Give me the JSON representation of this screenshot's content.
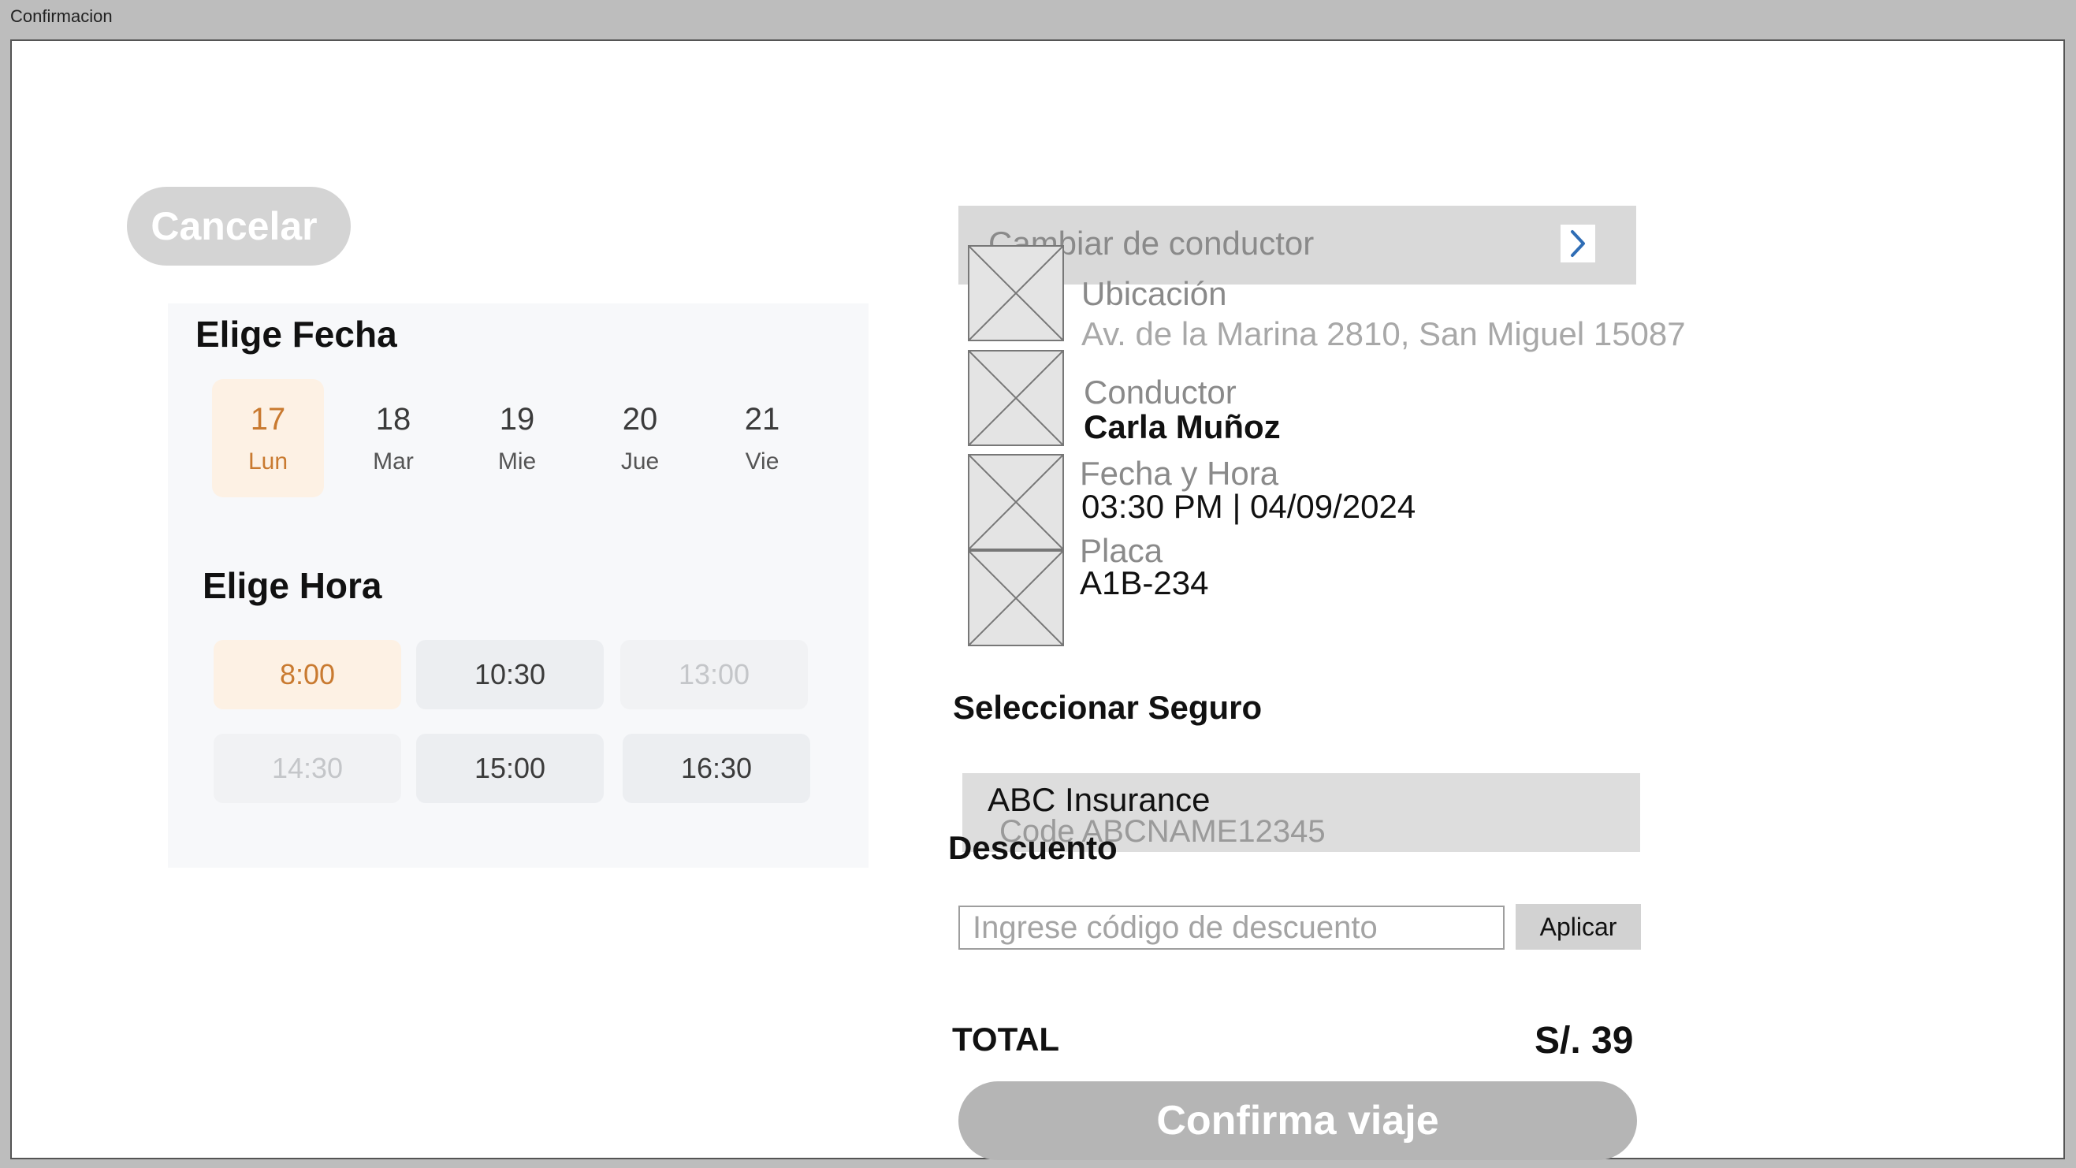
{
  "window": {
    "title": "Confirmacion"
  },
  "cancel_button": {
    "label": "Cancelar"
  },
  "date_picker": {
    "title": "Elige Fecha",
    "days": [
      {
        "num": "17",
        "dow": "Lun",
        "selected": true
      },
      {
        "num": "18",
        "dow": "Mar",
        "selected": false
      },
      {
        "num": "19",
        "dow": "Mie",
        "selected": false
      },
      {
        "num": "20",
        "dow": "Jue",
        "selected": false
      },
      {
        "num": "21",
        "dow": "Vie",
        "selected": false
      }
    ]
  },
  "time_picker": {
    "title": "Elige Hora",
    "slots": [
      {
        "label": "8:00",
        "state": "selected"
      },
      {
        "label": "10:30",
        "state": "available"
      },
      {
        "label": "13:00",
        "state": "disabled"
      },
      {
        "label": "14:30",
        "state": "disabled"
      },
      {
        "label": "15:00",
        "state": "available"
      },
      {
        "label": "16:30",
        "state": "available"
      }
    ]
  },
  "change_driver": {
    "label": "Cambiar de conductor",
    "icon": "chevron-right-icon",
    "icon_color": "#2f6db5"
  },
  "trip_info": {
    "location": {
      "label": "Ubicación",
      "value": "Av. de la Marina 2810, San Miguel 15087"
    },
    "driver": {
      "label": "Conductor",
      "value": "Carla Muñoz"
    },
    "datetime": {
      "label": "Fecha y Hora",
      "value": "03:30 PM | 04/09/2024"
    },
    "plate": {
      "label": "Placa",
      "value": "A1B-234"
    }
  },
  "insurance": {
    "section_label": "Seleccionar Seguro",
    "name": "ABC Insurance",
    "code": "Code ABCNAME12345"
  },
  "discount": {
    "section_label": "Descuento",
    "placeholder": "Ingrese código de descuento",
    "value": "",
    "apply_label": "Aplicar"
  },
  "total": {
    "label": "TOTAL",
    "value": "S/. 39"
  },
  "confirm_button": {
    "label": "Confirma viaje"
  },
  "colors": {
    "accent_selected": "#c97a30",
    "accent_selected_bg": "#fdf1e4",
    "button_grey": "#b5b5b5"
  }
}
